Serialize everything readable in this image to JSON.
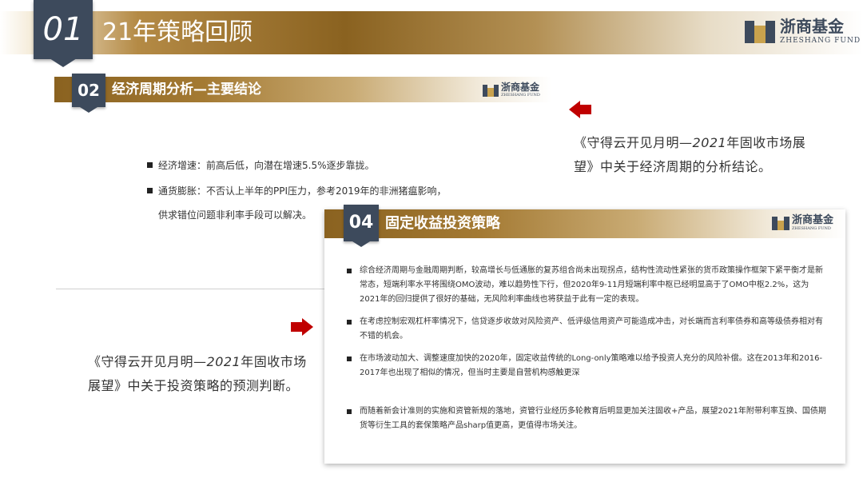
{
  "header": {
    "section_number": "01",
    "section_title": "21年策略回顾"
  },
  "logo": {
    "cn": "浙商基金",
    "en": "ZHESHANG FUND"
  },
  "panel_02": {
    "number": "02",
    "title": "经济周期分析—主要结论",
    "bullets": [
      "经济增速：前高后低，向潜在增速5.5%逐步靠拢。",
      "通货膨胀：不否认上半年的PPI压力，参考2019年的非洲猪瘟影响，"
    ],
    "continuation": "供求错位问题非利率手段可以解决。"
  },
  "panel_04": {
    "number": "04",
    "title": "固定收益投资策略",
    "bullets": [
      "综合经济周期与金融周期判断，较高增长与低通胀的复苏组合尚未出现拐点，结构性流动性紧张的货币政策操作框架下紧平衡才是新常态，短端利率水平将围绕OMO波动，难以趋势性下行，但2020年9-11月短端利率中枢已经明显高于了OMO中枢2.2%，这为2021年的回归提供了很好的基础，无风险利率曲线也将获益于此有一定的表现。",
      "在考虑控制宏观杠杆率情况下，信贷逐步收敛对风险资产、低评级信用资产可能造成冲击，对长端而言利率债券和高等级债券相对有不错的机会。",
      "在市场波动加大、调整速度加快的2020年，固定收益传统的Long-only策略难以给予投资人充分的风险补偿。这在2013年和2016-2017年也出现了相似的情况，但当时主要是自营机构感触更深",
      "而随着新会计准则的实施和资管新规的落地，资管行业经历多轮教育后明显更加关注固收+产品，展望2021年附带利率互换、国债期货等衍生工具的套保策略产品sharp值更高，更值得市场关注。"
    ]
  },
  "caption_right": {
    "prefix": "《守得云开见月明—",
    "year": "2021",
    "suffix": "年固收市场展望》中关于经济周期的分析结论。"
  },
  "caption_left": {
    "prefix": "《守得云开见月明—",
    "year": "2021",
    "suffix": "年固收市场展望》中关于投资策略的预测判断。"
  },
  "colors": {
    "navy": "#3d4a5c",
    "gold": "#8a6220",
    "arrow_red": "#c00000"
  },
  "icons": [
    "logo-mark-icon",
    "bullet-square-icon",
    "arrow-left-icon",
    "arrow-right-icon"
  ]
}
